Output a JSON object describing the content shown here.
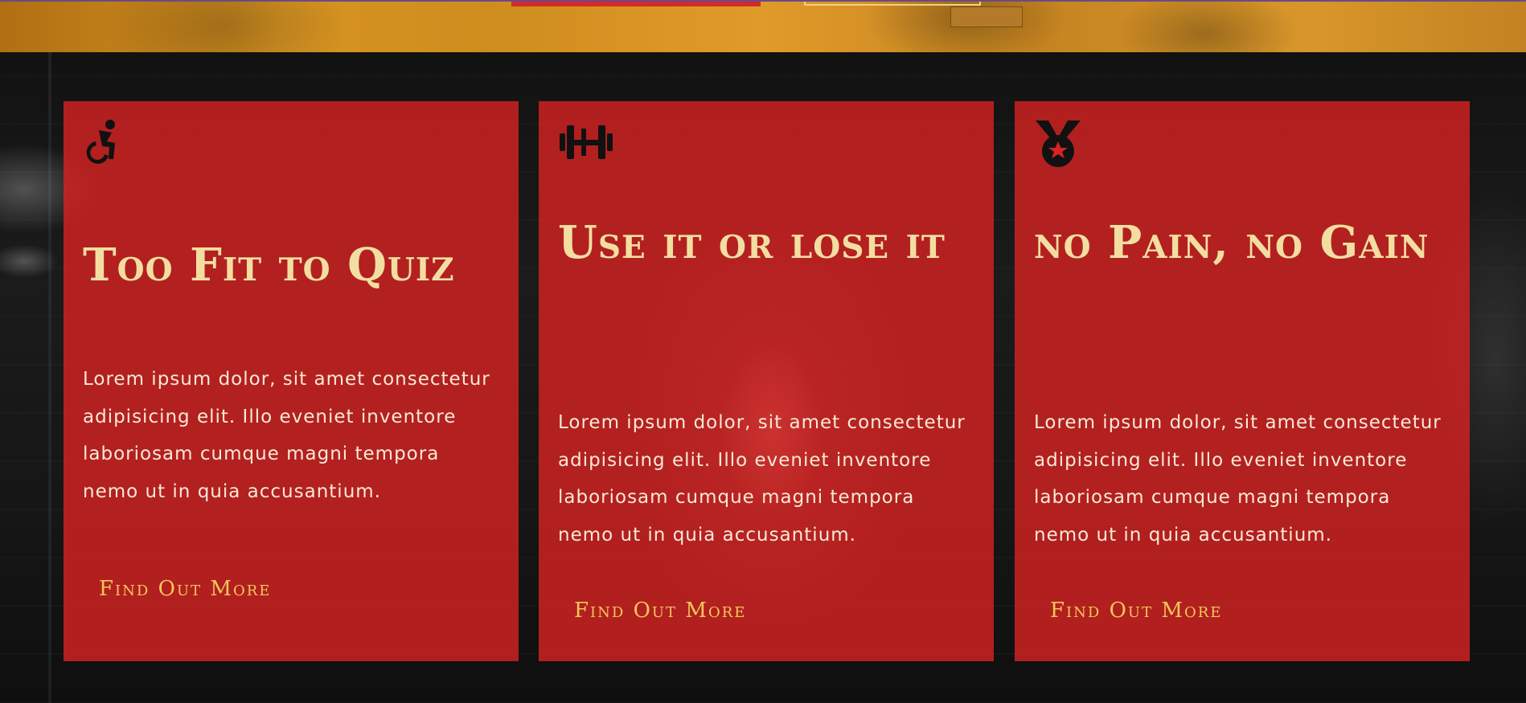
{
  "cards": [
    {
      "icon": "accessible-icon",
      "title": "Too Fit to Quiz",
      "body": "Lorem ipsum dolor, sit amet consectetur adipisicing elit. Illo eveniet inventore laboriosam cumque magni tempora nemo ut in quia accusantium.",
      "cta": "Find Out More"
    },
    {
      "icon": "dumbbell-icon",
      "title": "Use it or lose it",
      "body": "Lorem ipsum dolor, sit amet consectetur adipisicing elit. Illo eveniet inventore laboriosam cumque magni tempora nemo ut in quia accusantium.",
      "cta": "Find Out More"
    },
    {
      "icon": "medal-icon",
      "title": "no Pain, no Gain",
      "body": "Lorem ipsum dolor, sit amet consectetur adipisicing elit. Illo eveniet inventore laboriosam cumque magni tempora nemo ut in quia accusantium.",
      "cta": "Find Out More"
    }
  ],
  "colors": {
    "card_background": "#d62222",
    "title_text": "#f3dea1",
    "body_text": "#f7e9d6",
    "cta_text": "#f1c75a",
    "top_strip": "#d79422"
  }
}
